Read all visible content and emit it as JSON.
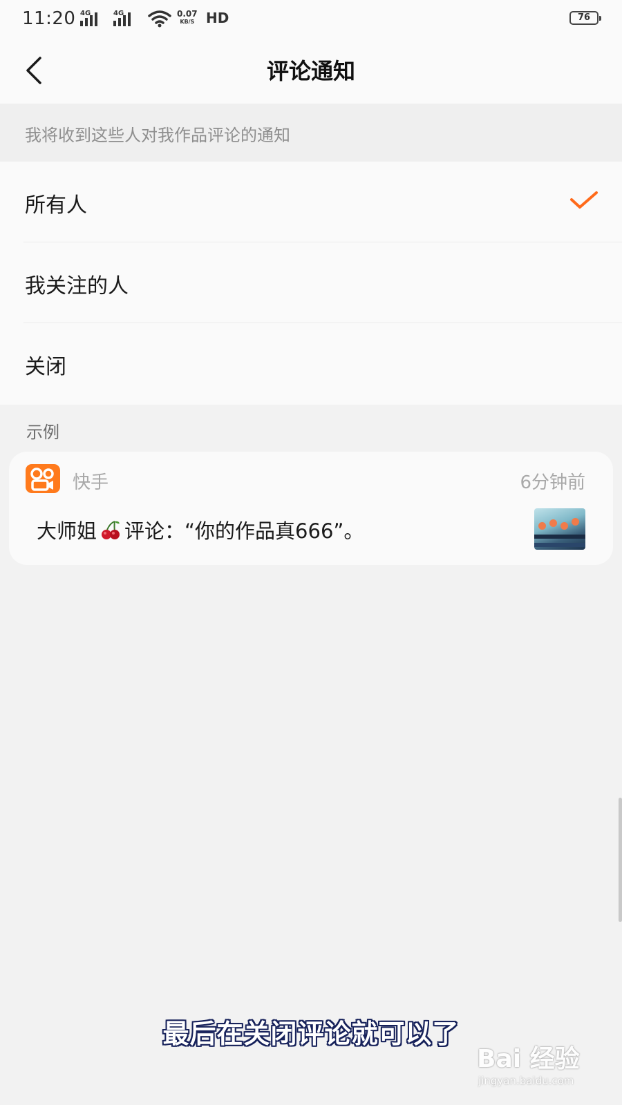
{
  "status_bar": {
    "time": "11:20",
    "network_1": "4G",
    "network_2": "4G",
    "speed_value": "0.07",
    "speed_unit": "KB/S",
    "hd": "HD",
    "battery": "76"
  },
  "nav": {
    "title": "评论通知"
  },
  "section": {
    "description": "我将收到这些人对我作品评论的通知"
  },
  "options": [
    {
      "label": "所有人",
      "selected": true
    },
    {
      "label": "我关注的人",
      "selected": false
    },
    {
      "label": "关闭",
      "selected": false
    }
  ],
  "example": {
    "label": "示例",
    "app_name": "快手",
    "time_ago": "6分钟前",
    "sender": "大师姐",
    "message": "评论：“你的作品真666”。"
  },
  "subtitle": "最后在关闭评论就可以了",
  "watermark": {
    "logo": "Bai 经验",
    "url": "jingyan.baidu.com"
  },
  "colors": {
    "accent": "#ff6a1a",
    "app_icon": "#ff7a1c",
    "subtitle_outline": "#16215a"
  }
}
